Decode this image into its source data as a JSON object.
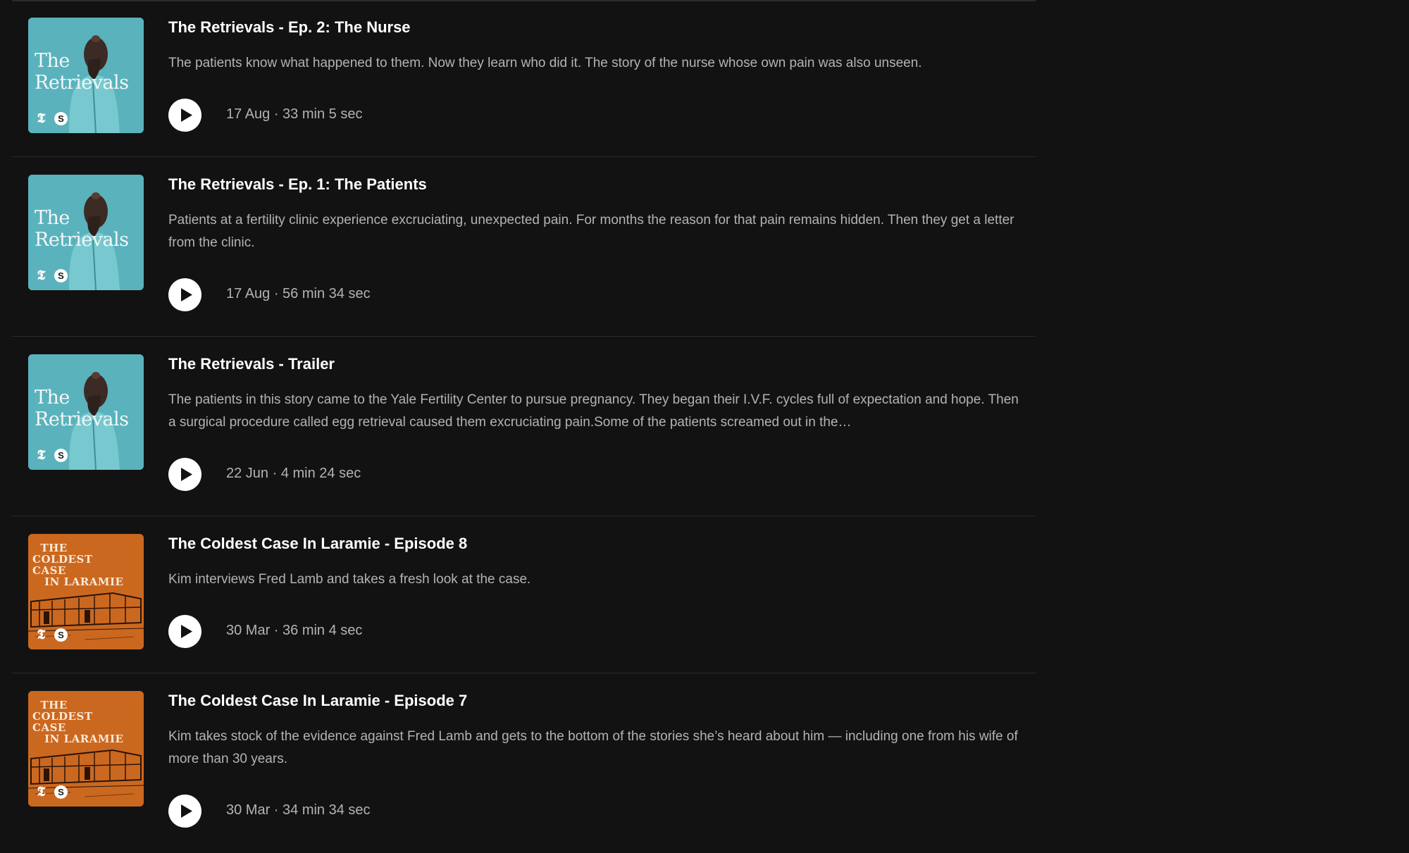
{
  "episodes": [
    {
      "show": "retrievals",
      "cover_text": "The\nRetrievals",
      "title": "The Retrievals - Ep. 2: The Nurse",
      "description": "The patients know what happened to them. Now they learn who did it. The story of the nurse whose own pain was also unseen.",
      "meta": "17 Aug · 33 min 5 sec"
    },
    {
      "show": "retrievals",
      "cover_text": "The\nRetrievals",
      "title": "The Retrievals - Ep. 1: The Patients",
      "description": "Patients at a fertility clinic experience excruciating, unexpected pain. For months the reason for that pain remains hidden. Then they get a letter from the clinic.",
      "meta": "17 Aug · 56 min 34 sec"
    },
    {
      "show": "retrievals",
      "cover_text": "The\nRetrievals",
      "title": "The Retrievals - Trailer",
      "description": "The patients in this story came to the Yale Fertility Center to pursue pregnancy. They began their I.V.F. cycles full of expectation and hope. Then a surgical procedure called egg retrieval caused them excruciating pain.Some of the patients screamed out in the…",
      "meta": "22 Jun · 4 min 24 sec"
    },
    {
      "show": "laramie",
      "cover_text": "  THE\nCOLDEST\nCASE\n   IN LARAMIE",
      "title": "The Coldest Case In Laramie - Episode 8",
      "description": "Kim interviews Fred Lamb and takes a fresh look at the case.",
      "meta": "30 Mar · 36 min 4 sec"
    },
    {
      "show": "laramie",
      "cover_text": "  THE\nCOLDEST\nCASE\n   IN LARAMIE",
      "title": "The Coldest Case In Laramie - Episode 7",
      "description": "Kim takes stock of the evidence against Fred Lamb and gets to the bottom of the stories she’s heard about him — including one from his wife of more than 30 years.",
      "meta": "30 Mar · 34 min 34 sec"
    }
  ],
  "badges": {
    "nyt": "𝕿",
    "serial": "S"
  },
  "colors": {
    "background": "#121212",
    "title": "#ffffff",
    "secondary_text": "#b3b3b3",
    "retrievals_cover": "#5ab2bd",
    "laramie_cover": "#d26e24"
  },
  "icons": {
    "play": "play-icon"
  }
}
